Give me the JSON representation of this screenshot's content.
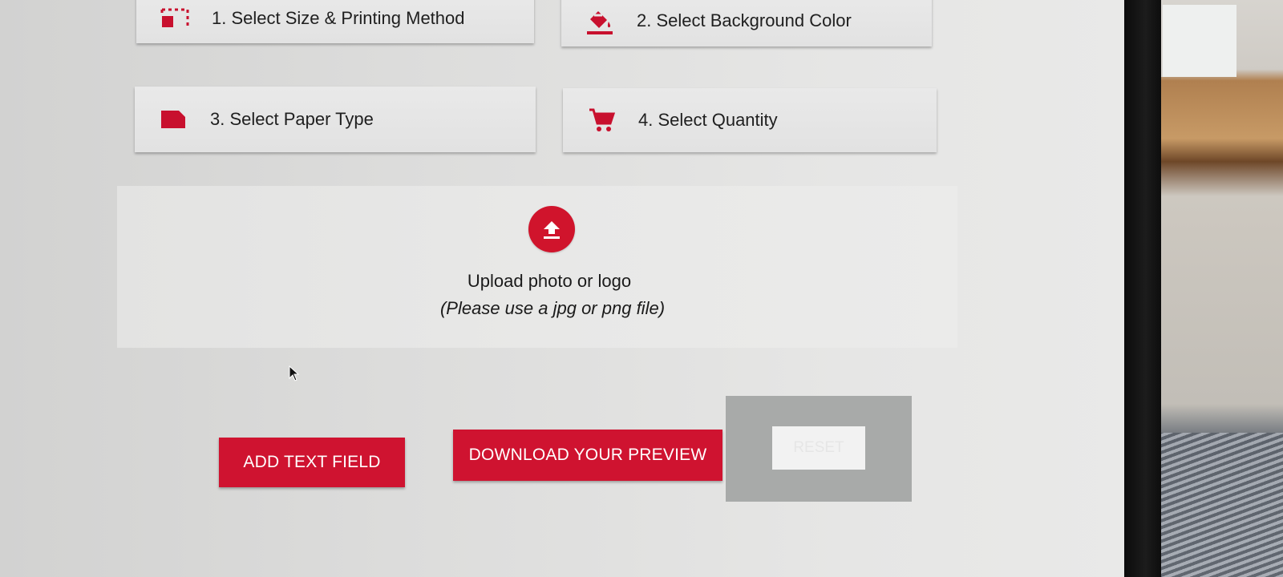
{
  "steps": [
    {
      "label": "1. Select Size & Printing Method",
      "icon": "crop-size-icon"
    },
    {
      "label": "2. Select Background Color",
      "icon": "paint-bucket-icon"
    },
    {
      "label": "3. Select Paper Type",
      "icon": "paper-icon"
    },
    {
      "label": "4. Select Quantity",
      "icon": "cart-icon"
    }
  ],
  "upload": {
    "title": "Upload photo or logo",
    "hint": "(Please use a jpg or png file)",
    "icon": "upload-icon"
  },
  "actions": {
    "add_text_field": "ADD TEXT FIELD",
    "download_preview": "DOWNLOAD YOUR PREVIEW",
    "reset": "RESET",
    "reset_disabled": true
  },
  "colors": {
    "accent": "#cf1330",
    "background": "#dcdcdb",
    "card": "#e6e6e6"
  }
}
